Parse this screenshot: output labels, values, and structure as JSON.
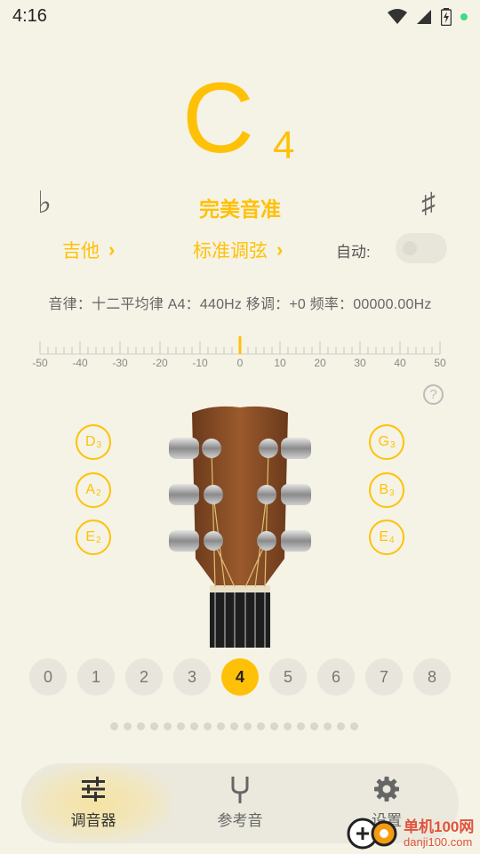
{
  "status_bar": {
    "time": "4:16",
    "icons": [
      "wifi-icon",
      "signal-icon",
      "battery-icon",
      "notification-dot"
    ]
  },
  "tuner": {
    "note_letter": "C",
    "note_octave": "4",
    "flat_symbol": "♭",
    "sharp_symbol": "♯",
    "status": "完美音准",
    "instrument": "吉他",
    "tuning": "标准调弦",
    "auto_label": "自动:",
    "auto_enabled": false,
    "info_line": "音律：十二平均律  A4：440Hz  移调：+0  频率：00000.00Hz",
    "ruler_labels": [
      "-50",
      "-40",
      "-30",
      "-20",
      "-10",
      "0",
      "10",
      "20",
      "30",
      "40",
      "50"
    ],
    "needle_cents": 0,
    "help_glyph": "?"
  },
  "strings_left": [
    {
      "note": "D",
      "octave": "3"
    },
    {
      "note": "A",
      "octave": "2"
    },
    {
      "note": "E",
      "octave": "2"
    }
  ],
  "strings_right": [
    {
      "note": "G",
      "octave": "3"
    },
    {
      "note": "B",
      "octave": "3"
    },
    {
      "note": "E",
      "octave": "4"
    }
  ],
  "capo": {
    "positions": [
      "0",
      "1",
      "2",
      "3",
      "4",
      "5",
      "6",
      "7",
      "8"
    ],
    "selected": "4"
  },
  "page_dots_count": 19,
  "bottom_nav": {
    "items": [
      {
        "label": "调音器",
        "icon": "sliders-icon",
        "active": true
      },
      {
        "label": "参考音",
        "icon": "tuning-fork-icon",
        "active": false
      },
      {
        "label": "设置",
        "icon": "gear-icon",
        "active": false
      }
    ]
  },
  "watermark": {
    "cn": "单机100网",
    "en": "danji100.com"
  },
  "colors": {
    "accent": "#ffc107",
    "background": "#f5f3e6",
    "text_muted": "#666666"
  }
}
